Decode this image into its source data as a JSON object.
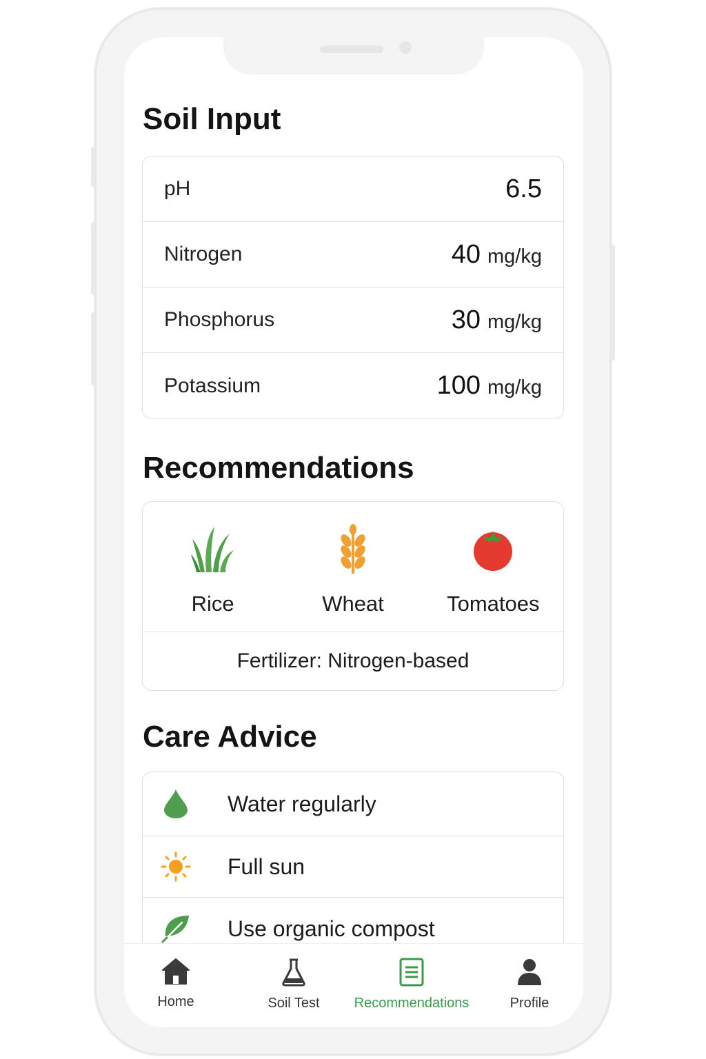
{
  "soil_input": {
    "title": "Soil Input",
    "rows": [
      {
        "label": "pH",
        "value": "6.5",
        "unit": ""
      },
      {
        "label": "Nitrogen",
        "value": "40",
        "unit": "mg/kg"
      },
      {
        "label": "Phosphorus",
        "value": "30",
        "unit": "mg/kg"
      },
      {
        "label": "Potassium",
        "value": "100",
        "unit": "mg/kg"
      }
    ]
  },
  "recommendations": {
    "title": "Recommendations",
    "crops": [
      {
        "label": "Rice",
        "icon": "rice-icon"
      },
      {
        "label": "Wheat",
        "icon": "wheat-icon"
      },
      {
        "label": "Tomatoes",
        "icon": "tomato-icon"
      }
    ],
    "fertilizer": "Fertilizer: Nitrogen-based"
  },
  "care_advice": {
    "title": "Care Advice",
    "items": [
      {
        "label": "Water regularly",
        "icon": "water-drop-icon"
      },
      {
        "label": "Full sun",
        "icon": "sun-icon"
      },
      {
        "label": "Use organic compost",
        "icon": "leaf-icon"
      }
    ]
  },
  "tabbar": {
    "tabs": [
      {
        "label": "Home",
        "icon": "home-icon"
      },
      {
        "label": "Soil Test",
        "icon": "flask-icon"
      },
      {
        "label": "Recommendations",
        "icon": "document-icon",
        "active": true
      },
      {
        "label": "Profile",
        "icon": "person-icon"
      }
    ]
  },
  "colors": {
    "accent_green": "#3a9a46",
    "wheat_orange": "#f0a030",
    "tomato_red": "#e53a2f",
    "sun_orange": "#f5a020"
  }
}
